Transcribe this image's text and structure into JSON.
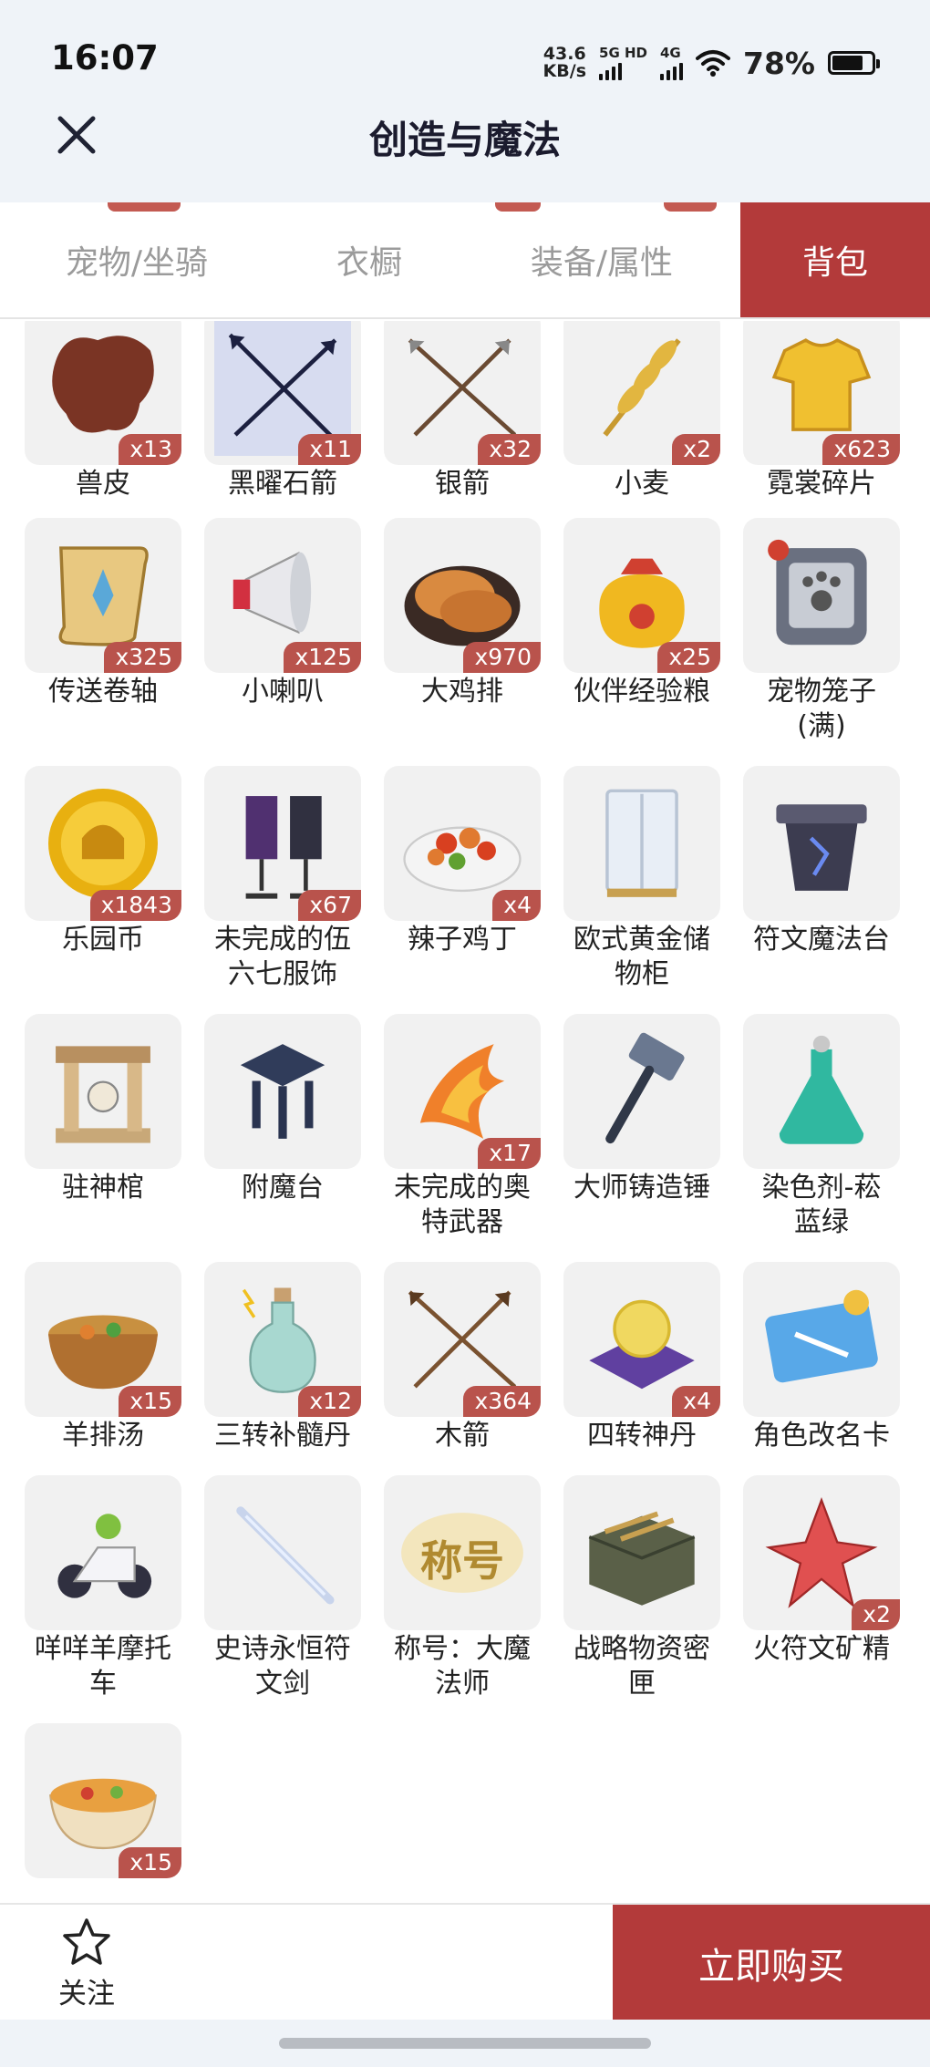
{
  "status": {
    "time": "16:07",
    "net_speed_value": "43.6",
    "net_speed_unit": "KB/s",
    "net_type_1": "5G HD",
    "net_type_2": "4G",
    "battery_pct": "78%",
    "battery_level": 0.78
  },
  "header": {
    "title": "创造与魔法",
    "close_icon": "close-icon"
  },
  "tabs": [
    {
      "label": "宠物/坐骑",
      "active": false
    },
    {
      "label": "衣橱",
      "active": false
    },
    {
      "label": "装备/属性",
      "active": false
    },
    {
      "label": "背包",
      "active": true
    }
  ],
  "items": [
    {
      "name": "兽皮",
      "qty": "x13",
      "icon": "animal-hide-icon"
    },
    {
      "name": "黑曜石箭",
      "qty": "x11",
      "icon": "obsidian-arrows-icon"
    },
    {
      "name": "银箭",
      "qty": "x32",
      "icon": "silver-arrows-icon"
    },
    {
      "name": "小麦",
      "qty": "x2",
      "icon": "wheat-icon"
    },
    {
      "name": "霓裳碎片",
      "qty": "x623",
      "icon": "shirt-fragment-icon"
    },
    {
      "name": "传送卷轴",
      "qty": "x325",
      "icon": "teleport-scroll-icon"
    },
    {
      "name": "小喇叭",
      "qty": "x125",
      "icon": "megaphone-icon"
    },
    {
      "name": "大鸡排",
      "qty": "x970",
      "icon": "chicken-cutlet-icon"
    },
    {
      "name": "伙伴经验粮",
      "qty": "x25",
      "icon": "exp-food-bag-icon"
    },
    {
      "name": "宠物笼子\n(满)",
      "qty": "",
      "icon": "pet-cage-icon"
    },
    {
      "name": "乐园币",
      "qty": "x1843",
      "icon": "park-coin-icon"
    },
    {
      "name": "未完成的伍\n六七服饰",
      "qty": "x67",
      "icon": "costume-stand-icon"
    },
    {
      "name": "辣子鸡丁",
      "qty": "x4",
      "icon": "spicy-chicken-icon"
    },
    {
      "name": "欧式黄金储\n物柜",
      "qty": "",
      "icon": "wardrobe-icon"
    },
    {
      "name": "符文魔法台",
      "qty": "",
      "icon": "rune-table-icon"
    },
    {
      "name": "驻神棺",
      "qty": "",
      "icon": "shrine-icon"
    },
    {
      "name": "附魔台",
      "qty": "",
      "icon": "enchant-table-icon"
    },
    {
      "name": "未完成的奥\n特武器",
      "qty": "x17",
      "icon": "fire-weapon-icon"
    },
    {
      "name": "大师铸造锤",
      "qty": "",
      "icon": "hammer-icon"
    },
    {
      "name": "染色剂-菘\n蓝绿",
      "qty": "",
      "icon": "dye-flask-icon"
    },
    {
      "name": "羊排汤",
      "qty": "x15",
      "icon": "soup-bowl-icon"
    },
    {
      "name": "三转补髓丹",
      "qty": "x12",
      "icon": "potion-bottle-icon"
    },
    {
      "name": "木箭",
      "qty": "x364",
      "icon": "wooden-arrows-icon"
    },
    {
      "name": "四转神丹",
      "qty": "x4",
      "icon": "pill-cushion-icon"
    },
    {
      "name": "角色改名卡",
      "qty": "",
      "icon": "rename-card-icon"
    },
    {
      "name": "咩咩羊摩托\n车",
      "qty": "",
      "icon": "motorbike-icon"
    },
    {
      "name": "史诗永恒符\n文剑",
      "qty": "",
      "icon": "rune-sword-icon"
    },
    {
      "name": "称号：大魔\n法师",
      "qty": "",
      "icon": "title-badge-icon",
      "badge_text": "称号"
    },
    {
      "name": "战略物资密\n匣",
      "qty": "",
      "icon": "supply-crate-icon"
    },
    {
      "name": "火符文矿精",
      "qty": "x2",
      "icon": "fire-crystal-icon"
    },
    {
      "name": "",
      "qty": "x15",
      "icon": "stew-pot-icon"
    }
  ],
  "bottom": {
    "follow_label": "关注",
    "buy_label": "立即购买"
  },
  "colors": {
    "accent": "#b33a3a",
    "qty_badge": "#b9534c",
    "tile_bg": "#f1f1f1",
    "header_bg": "#eff3f8"
  }
}
